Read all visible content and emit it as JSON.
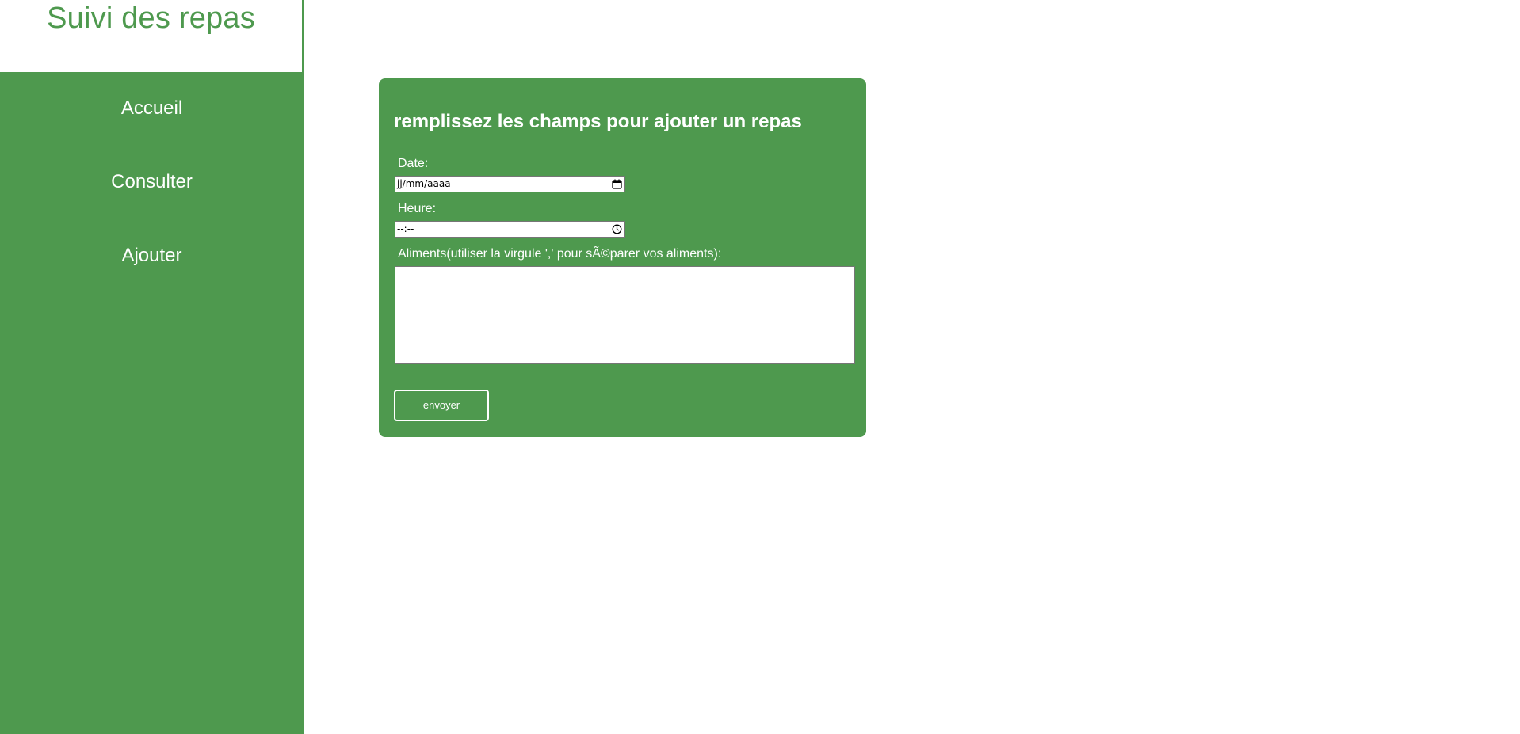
{
  "brand": {
    "title": "Suivi des repas"
  },
  "nav": {
    "items": [
      {
        "label": "Accueil"
      },
      {
        "label": "Consulter"
      },
      {
        "label": "Ajouter"
      }
    ]
  },
  "form": {
    "title": "remplissez les champs pour ajouter un repas",
    "date": {
      "label": "Date:",
      "placeholder": "jj/mm/aaaa",
      "icon": "calendar-icon"
    },
    "time": {
      "label": "Heure:",
      "placeholder": "--:--",
      "icon": "clock-icon"
    },
    "foods": {
      "label": "Aliments(utiliser la virgule ','  pour sÃ©parer vos aliments):",
      "value": ""
    },
    "submit_label": "envoyer"
  },
  "colors": {
    "primary_green": "#4e994e",
    "text_on_green": "#ffffff",
    "background": "#ffffff"
  }
}
